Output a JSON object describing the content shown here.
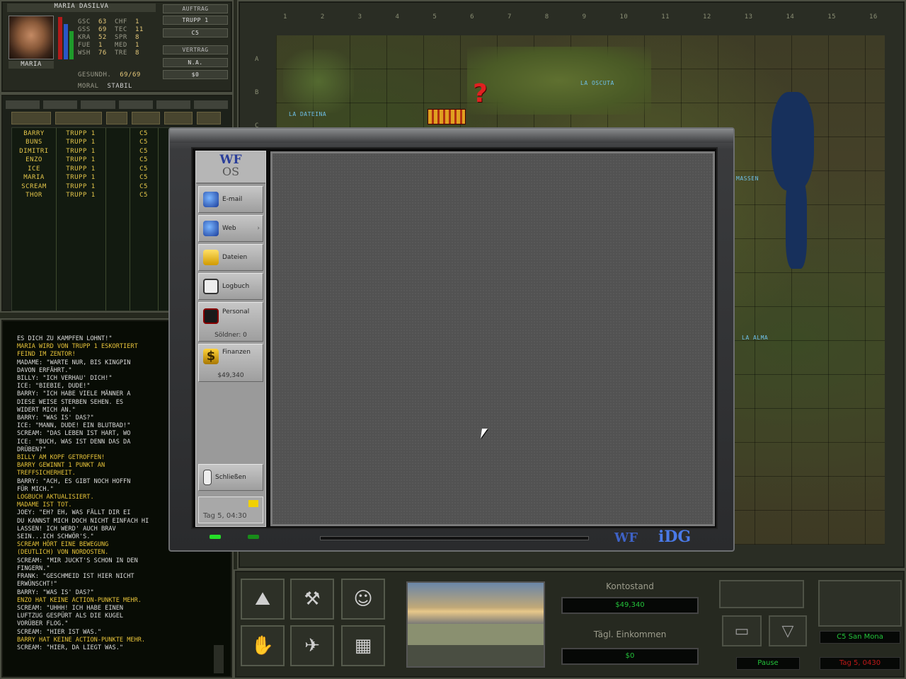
{
  "merc": {
    "name": "Maria DaSilva",
    "nickname": "Maria",
    "stats": [
      {
        "k": "Gsc",
        "v": "63",
        "k2": "Chf",
        "v2": "1"
      },
      {
        "k": "Gss",
        "v": "69",
        "k2": "Tec",
        "v2": "11"
      },
      {
        "k": "Kra",
        "v": "52",
        "k2": "Spr",
        "v2": "8"
      },
      {
        "k": "Fue",
        "v": "1",
        "k2": "Med",
        "v2": "1"
      },
      {
        "k": "Wsh",
        "v": "76",
        "k2": "Tre",
        "v2": "8"
      }
    ],
    "hp_label": "Gesundh.",
    "hp_value": "69/69",
    "moral_label": "Moral",
    "moral_value": "Stabil",
    "buttons": {
      "auftrag": "Auftrag",
      "trupp": "Trupp 1",
      "sector": "C5",
      "vertrag": "Vertrag",
      "na": "N.A.",
      "money": "$0"
    }
  },
  "squad": {
    "rows": [
      {
        "name": "Barry",
        "unit": "Trupp 1",
        "sector": "C5"
      },
      {
        "name": "Buns",
        "unit": "Trupp 1",
        "sector": "C5"
      },
      {
        "name": "Dimitri",
        "unit": "Trupp 1",
        "sector": "C5"
      },
      {
        "name": "Enzo",
        "unit": "Trupp 1",
        "sector": "C5"
      },
      {
        "name": "Ice",
        "unit": "Trupp 1",
        "sector": "C5"
      },
      {
        "name": "Maria",
        "unit": "Trupp 1",
        "sector": "C5"
      },
      {
        "name": "Scream",
        "unit": "Trupp 1",
        "sector": "C5"
      },
      {
        "name": "Thor",
        "unit": "Trupp 1",
        "sector": "C5"
      }
    ]
  },
  "log": {
    "lines": [
      {
        "t": "es dich zu kämpfen lohnt!\"",
        "c": "w"
      },
      {
        "t": "Maria wird von Trupp 1 eskortiert",
        "c": "y"
      },
      {
        "t": "Feind im Zentor!",
        "c": "y"
      },
      {
        "t": "Madame: \"Warte nur, bis Kingpin",
        "c": "w"
      },
      {
        "t": "davon erfährt.\"",
        "c": "w"
      },
      {
        "t": "Billy: \"Ich verhau' dich!\"",
        "c": "w"
      },
      {
        "t": "Ice: \"Biebie, Dude!\"",
        "c": "w"
      },
      {
        "t": "Barry: \"Ich habe viele Männer a",
        "c": "w"
      },
      {
        "t": "diese Weise sterben sehen. Es",
        "c": "w"
      },
      {
        "t": "widert mich an.\"",
        "c": "w"
      },
      {
        "t": "Barry: \"Was is' das?\"",
        "c": "w"
      },
      {
        "t": "Ice: \"Mann, Dude! Ein Blutbad!\"",
        "c": "w"
      },
      {
        "t": "Scream: \"Das Leben ist hart, wo",
        "c": "w"
      },
      {
        "t": "Ice: \"Buch, was ist denn das da",
        "c": "w"
      },
      {
        "t": "drüben?\"",
        "c": "w"
      },
      {
        "t": "Billy am Kopf getroffen!",
        "c": "y"
      },
      {
        "t": "Barry gewinnt 1 Punkt an",
        "c": "y"
      },
      {
        "t": "Treffsicherheit.",
        "c": "y"
      },
      {
        "t": "Barry: \"Ach, es gibt noch Hoffn",
        "c": "w"
      },
      {
        "t": "für mich.\"",
        "c": "w"
      },
      {
        "t": "Logbuch aktualisiert.",
        "c": "y"
      },
      {
        "t": "Madame ist tot.",
        "c": "y"
      },
      {
        "t": "Joey: \"Eh? Eh, was fällt dir ei",
        "c": "w"
      },
      {
        "t": "Du kannst mich doch nicht einfach hi",
        "c": "w"
      },
      {
        "t": "lassen! Ich werd' auch brav",
        "c": "w"
      },
      {
        "t": "sein...ich schwör's.\"",
        "c": "w"
      },
      {
        "t": "Scream hört eine Bewegung",
        "c": "y"
      },
      {
        "t": "(deutlich) von Nordosten.",
        "c": "y"
      },
      {
        "t": "Scream: \"Mir juckt's schon in den",
        "c": "w"
      },
      {
        "t": "Fingern.\"",
        "c": "w"
      },
      {
        "t": "Frank: \"Geschmeid ist hier nicht",
        "c": "w"
      },
      {
        "t": "erwünscht!\"",
        "c": "w"
      },
      {
        "t": "Barry: \"Was is' das?\"",
        "c": "w"
      },
      {
        "t": "Enzo hat keine Action-Punkte mehr.",
        "c": "y"
      },
      {
        "t": "Scream: \"Uhhh! Ich habe einen",
        "c": "w"
      },
      {
        "t": "Luftzug gespürt als die Kugel",
        "c": "w"
      },
      {
        "t": "vorüber flog.\"",
        "c": "w"
      },
      {
        "t": "Scream: \"Hier ist was.\"",
        "c": "w"
      },
      {
        "t": "Barry hat keine Action-Punkte mehr.",
        "c": "y"
      },
      {
        "t": "Scream: \"Hier, da liegt was.\"",
        "c": "w"
      }
    ]
  },
  "map": {
    "columns": [
      "1",
      "2",
      "3",
      "4",
      "5",
      "6",
      "7",
      "8",
      "9",
      "10",
      "11",
      "12",
      "13",
      "14",
      "15",
      "16"
    ],
    "rows": [
      "A",
      "B",
      "C"
    ],
    "towns": [
      {
        "name": "La Dateina",
        "cls": "t1"
      },
      {
        "name": "La Oscuta",
        "cls": "t2"
      },
      {
        "name": "Massen",
        "cls": "t3"
      },
      {
        "name": "La Alma",
        "cls": "t4"
      }
    ]
  },
  "laptop": {
    "logo_top": "WF",
    "logo_bottom": "OS",
    "buttons": [
      {
        "label": "E-mail",
        "icon": "email-icon",
        "name": "email"
      },
      {
        "label": "Web",
        "icon": "globe-icon",
        "name": "web"
      },
      {
        "label": "Dateien",
        "icon": "folder-icon",
        "name": "files"
      },
      {
        "label": "Logbuch",
        "icon": "book-icon",
        "name": "logbook"
      }
    ],
    "personal_label": "Personal",
    "personal_sub": "Söldner: 0",
    "finance_label": "Finanzen",
    "finance_sub": "$49,340",
    "close_label": "Schließen",
    "day_label": "Tag 5, 04:30",
    "brand_left": "WF",
    "brand_right": "iDG"
  },
  "bottom": {
    "balance_label": "Kontostand",
    "balance_value": "$49,340",
    "income_label": "Tägl. Einkommen",
    "income_value": "$0",
    "sector_status": "C5 San Mona",
    "pause_label": "Pause",
    "time_status": "Tag 5, 0430"
  },
  "colors": {
    "accent_yellow": "#e3c54a",
    "money_green": "#23c23a",
    "town_blue": "#6fc0e8"
  }
}
